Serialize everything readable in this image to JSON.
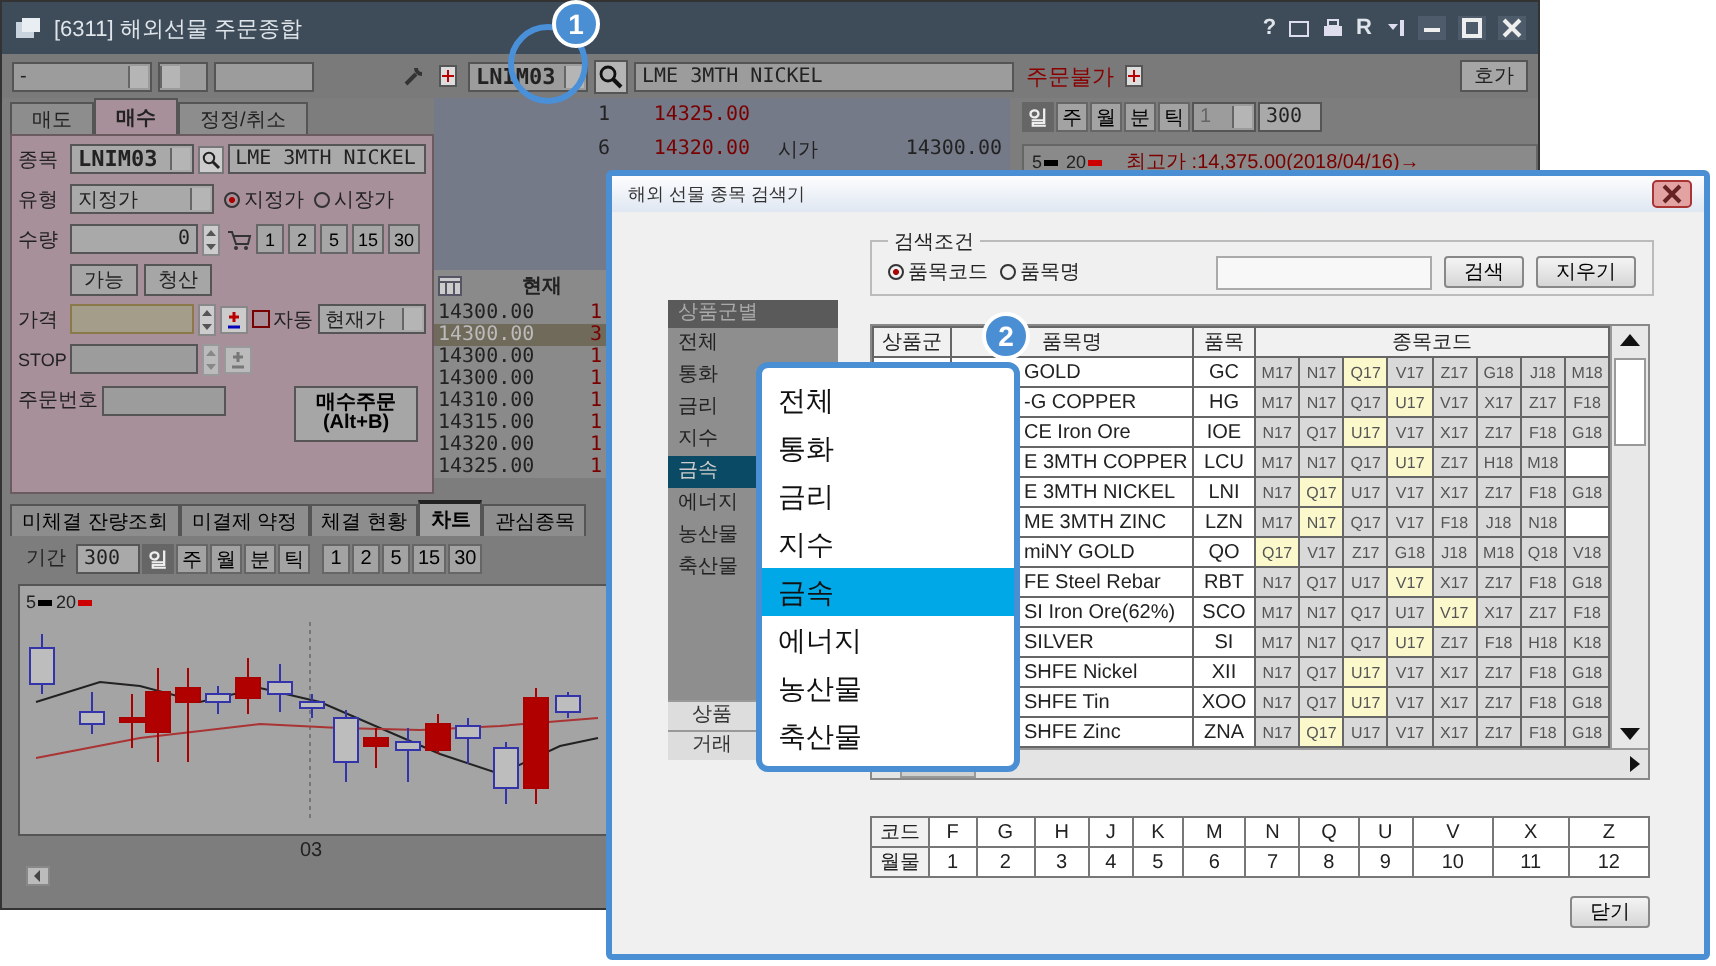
{
  "window": {
    "title": "[6311] 해외선물 주문종합",
    "glyphs": [
      "?",
      "R"
    ]
  },
  "toolbar": {
    "account": "-",
    "symbol": "LNIM03",
    "symbol_name": "LME 3MTH NICKEL",
    "status": "주문불가",
    "quote_button": "호가"
  },
  "order_tabs": [
    {
      "label": "매도",
      "selected": false
    },
    {
      "label": "매수",
      "selected": true
    },
    {
      "label": "정정/취소",
      "selected": false
    }
  ],
  "order_form": {
    "symbol_label": "종목",
    "symbol": "LNIM03",
    "symbol_name": "LME 3MTH NICKEL",
    "type_label": "유형",
    "type_value": "지정가",
    "price_types": [
      {
        "label": "지정가",
        "selected": true
      },
      {
        "label": "시장가",
        "selected": false
      }
    ],
    "qty_label": "수량",
    "qty": "0",
    "qty_presets": [
      "1",
      "2",
      "5",
      "15",
      "30"
    ],
    "buttons": [
      "가능",
      "청산"
    ],
    "price_label": "가격",
    "auto": {
      "label": "자동",
      "checked": false
    },
    "price_source": "현재가",
    "stop_label": "STOP",
    "order_no_label": "주문번호",
    "submit": "매수주문\n(Alt+B)"
  },
  "quotes": [
    {
      "count": "1",
      "price": "14325.00"
    },
    {
      "count": "6",
      "price": "14320.00",
      "label": "시가",
      "value": "14300.00"
    }
  ],
  "ticks": {
    "header": "현재",
    "rows": [
      {
        "price": "14300.00",
        "qty": "1",
        "selected": false
      },
      {
        "price": "14300.00",
        "qty": "3",
        "selected": true
      },
      {
        "price": "14300.00",
        "qty": "1",
        "selected": false
      },
      {
        "price": "14300.00",
        "qty": "1",
        "selected": false
      },
      {
        "price": "14310.00",
        "qty": "1",
        "selected": false
      },
      {
        "price": "14315.00",
        "qty": "1",
        "selected": false
      },
      {
        "price": "14320.00",
        "qty": "1",
        "selected": false
      },
      {
        "price": "14325.00",
        "qty": "1",
        "selected": false
      }
    ]
  },
  "mini_chart": {
    "periods": [
      {
        "label": "일",
        "selected": true
      },
      {
        "label": "주",
        "selected": false
      },
      {
        "label": "월",
        "selected": false
      },
      {
        "label": "분",
        "selected": false
      },
      {
        "label": "틱",
        "selected": false
      }
    ],
    "interval": "1",
    "count": "300",
    "legend": [
      {
        "label": "5",
        "color": "#000000"
      },
      {
        "label": "20",
        "color": "#cc0000"
      }
    ],
    "high_note": "최고가 :14,375.00(2018/04/16)→"
  },
  "bottom_tabs": [
    {
      "label": "미체결 잔량조회",
      "selected": false
    },
    {
      "label": "미결제 약정",
      "selected": false
    },
    {
      "label": "체결 현황",
      "selected": false
    },
    {
      "label": "차트",
      "selected": true
    },
    {
      "label": "관심종목",
      "selected": false
    }
  ],
  "chart": {
    "period_label": "기간",
    "period_value": "300",
    "periods": [
      {
        "label": "일",
        "selected": true
      },
      {
        "label": "주",
        "selected": false
      },
      {
        "label": "월",
        "selected": false
      },
      {
        "label": "분",
        "selected": false
      },
      {
        "label": "틱",
        "selected": false
      }
    ],
    "intervals": [
      "1",
      "2",
      "5",
      "15",
      "30"
    ],
    "legend": [
      {
        "label": "5",
        "color": "#000000"
      },
      {
        "label": "20",
        "color": "#cc0000"
      }
    ],
    "x_label": "03"
  },
  "dialog": {
    "title": "해외 선물 종목 검색기",
    "search": {
      "legend": "검색조건",
      "modes": [
        {
          "label": "품목코드",
          "selected": true
        },
        {
          "label": "품목명",
          "selected": false
        }
      ],
      "buttons": [
        "검색",
        "지우기"
      ]
    },
    "groups": {
      "header": "상품군별",
      "items": [
        {
          "label": "전체",
          "selected": false
        },
        {
          "label": "통화",
          "selected": false
        },
        {
          "label": "금리",
          "selected": false
        },
        {
          "label": "지수",
          "selected": false
        },
        {
          "label": "금속",
          "selected": true
        },
        {
          "label": "에너지",
          "selected": false
        },
        {
          "label": "농산물",
          "selected": false
        },
        {
          "label": "축산물",
          "selected": false
        }
      ],
      "footer": [
        "상품",
        "거래"
      ]
    },
    "table": {
      "columns": [
        "상품군",
        "품목명",
        "품목",
        "종목코드"
      ],
      "rows": [
        {
          "name": "GOLD",
          "code": "GC",
          "contracts": [
            {
              "code": "M17",
              "highlighted": false
            },
            {
              "code": "N17",
              "highlighted": false
            },
            {
              "code": "Q17",
              "highlighted": true
            },
            {
              "code": "V17",
              "highlighted": false
            },
            {
              "code": "Z17",
              "highlighted": false
            },
            {
              "code": "G18",
              "highlighted": false
            },
            {
              "code": "J18",
              "highlighted": false
            },
            {
              "code": "M18",
              "highlighted": false
            }
          ]
        },
        {
          "name": "-G COPPER",
          "code": "HG",
          "contracts": [
            {
              "code": "M17",
              "highlighted": false
            },
            {
              "code": "N17",
              "highlighted": false
            },
            {
              "code": "Q17",
              "highlighted": false
            },
            {
              "code": "U17",
              "highlighted": true
            },
            {
              "code": "V17",
              "highlighted": false
            },
            {
              "code": "X17",
              "highlighted": false
            },
            {
              "code": "Z17",
              "highlighted": false
            },
            {
              "code": "F18",
              "highlighted": false
            }
          ]
        },
        {
          "name": "CE Iron Ore",
          "code": "IOE",
          "contracts": [
            {
              "code": "N17",
              "highlighted": false
            },
            {
              "code": "Q17",
              "highlighted": false
            },
            {
              "code": "U17",
              "highlighted": true
            },
            {
              "code": "V17",
              "highlighted": false
            },
            {
              "code": "X17",
              "highlighted": false
            },
            {
              "code": "Z17",
              "highlighted": false
            },
            {
              "code": "F18",
              "highlighted": false
            },
            {
              "code": "G18",
              "highlighted": false
            }
          ]
        },
        {
          "name": "E 3MTH COPPER",
          "code": "LCU",
          "contracts": [
            {
              "code": "M17",
              "highlighted": false
            },
            {
              "code": "N17",
              "highlighted": false
            },
            {
              "code": "Q17",
              "highlighted": false
            },
            {
              "code": "U17",
              "highlighted": true
            },
            {
              "code": "Z17",
              "highlighted": false
            },
            {
              "code": "H18",
              "highlighted": false
            },
            {
              "code": "M18",
              "highlighted": false
            }
          ]
        },
        {
          "name": "E 3MTH NICKEL",
          "code": "LNI",
          "contracts": [
            {
              "code": "N17",
              "highlighted": false
            },
            {
              "code": "Q17",
              "highlighted": true
            },
            {
              "code": "U17",
              "highlighted": false
            },
            {
              "code": "V17",
              "highlighted": false
            },
            {
              "code": "X17",
              "highlighted": false
            },
            {
              "code": "Z17",
              "highlighted": false
            },
            {
              "code": "F18",
              "highlighted": false
            },
            {
              "code": "G18",
              "highlighted": false
            }
          ]
        },
        {
          "name": "ME 3MTH ZINC",
          "code": "LZN",
          "contracts": [
            {
              "code": "M17",
              "highlighted": false
            },
            {
              "code": "N17",
              "highlighted": true
            },
            {
              "code": "Q17",
              "highlighted": false
            },
            {
              "code": "V17",
              "highlighted": false
            },
            {
              "code": "F18",
              "highlighted": false
            },
            {
              "code": "J18",
              "highlighted": false
            },
            {
              "code": "N18",
              "highlighted": false
            }
          ]
        },
        {
          "name": "miNY GOLD",
          "code": "QO",
          "contracts": [
            {
              "code": "Q17",
              "highlighted": true
            },
            {
              "code": "V17",
              "highlighted": false
            },
            {
              "code": "Z17",
              "highlighted": false
            },
            {
              "code": "G18",
              "highlighted": false
            },
            {
              "code": "J18",
              "highlighted": false
            },
            {
              "code": "M18",
              "highlighted": false
            },
            {
              "code": "Q18",
              "highlighted": false
            },
            {
              "code": "V18",
              "highlighted": false
            }
          ]
        },
        {
          "name": "FE Steel Rebar",
          "code": "RBT",
          "contracts": [
            {
              "code": "N17",
              "highlighted": false
            },
            {
              "code": "Q17",
              "highlighted": false
            },
            {
              "code": "U17",
              "highlighted": false
            },
            {
              "code": "V17",
              "highlighted": true
            },
            {
              "code": "X17",
              "highlighted": false
            },
            {
              "code": "Z17",
              "highlighted": false
            },
            {
              "code": "F18",
              "highlighted": false
            },
            {
              "code": "G18",
              "highlighted": false
            }
          ]
        },
        {
          "name": "SI Iron Ore(62%)",
          "code": "SCO",
          "contracts": [
            {
              "code": "M17",
              "highlighted": false
            },
            {
              "code": "N17",
              "highlighted": false
            },
            {
              "code": "Q17",
              "highlighted": false
            },
            {
              "code": "U17",
              "highlighted": false
            },
            {
              "code": "V17",
              "highlighted": true
            },
            {
              "code": "X17",
              "highlighted": false
            },
            {
              "code": "Z17",
              "highlighted": false
            },
            {
              "code": "F18",
              "highlighted": false
            }
          ]
        },
        {
          "name": "SILVER",
          "code": "SI",
          "contracts": [
            {
              "code": "M17",
              "highlighted": false
            },
            {
              "code": "N17",
              "highlighted": false
            },
            {
              "code": "Q17",
              "highlighted": false
            },
            {
              "code": "U17",
              "highlighted": true
            },
            {
              "code": "Z17",
              "highlighted": false
            },
            {
              "code": "F18",
              "highlighted": false
            },
            {
              "code": "H18",
              "highlighted": false
            },
            {
              "code": "K18",
              "highlighted": false
            }
          ]
        },
        {
          "name": "SHFE Nickel",
          "code": "XII",
          "contracts": [
            {
              "code": "N17",
              "highlighted": false
            },
            {
              "code": "Q17",
              "highlighted": false
            },
            {
              "code": "U17",
              "highlighted": true
            },
            {
              "code": "V17",
              "highlighted": false
            },
            {
              "code": "X17",
              "highlighted": false
            },
            {
              "code": "Z17",
              "highlighted": false
            },
            {
              "code": "F18",
              "highlighted": false
            },
            {
              "code": "G18",
              "highlighted": false
            }
          ]
        },
        {
          "name": "SHFE Tin",
          "code": "XOO",
          "contracts": [
            {
              "code": "N17",
              "highlighted": false
            },
            {
              "code": "Q17",
              "highlighted": false
            },
            {
              "code": "U17",
              "highlighted": true
            },
            {
              "code": "V17",
              "highlighted": false
            },
            {
              "code": "X17",
              "highlighted": false
            },
            {
              "code": "Z17",
              "highlighted": false
            },
            {
              "code": "F18",
              "highlighted": false
            },
            {
              "code": "G18",
              "highlighted": false
            }
          ]
        },
        {
          "name": "SHFE Zinc",
          "code": "ZNA",
          "contracts": [
            {
              "code": "N17",
              "highlighted": false
            },
            {
              "code": "Q17",
              "highlighted": true
            },
            {
              "code": "U17",
              "highlighted": false
            },
            {
              "code": "V17",
              "highlighted": false
            },
            {
              "code": "X17",
              "highlighted": false
            },
            {
              "code": "Z17",
              "highlighted": false
            },
            {
              "code": "F18",
              "highlighted": false
            },
            {
              "code": "G18",
              "highlighted": false
            }
          ]
        }
      ]
    },
    "months": {
      "row_labels": [
        "코드",
        "월물"
      ],
      "codes": [
        "F",
        "G",
        "H",
        "J",
        "K",
        "M",
        "N",
        "Q",
        "U",
        "V",
        "X",
        "Z"
      ],
      "numbers": [
        "1",
        "2",
        "3",
        "4",
        "5",
        "6",
        "7",
        "8",
        "9",
        "10",
        "11",
        "12"
      ]
    },
    "close_button": "닫기"
  },
  "popup": {
    "items": [
      {
        "label": "전체",
        "selected": false
      },
      {
        "label": "통화",
        "selected": false
      },
      {
        "label": "금리",
        "selected": false
      },
      {
        "label": "지수",
        "selected": false
      },
      {
        "label": "금속",
        "selected": true
      },
      {
        "label": "에너지",
        "selected": false
      },
      {
        "label": "농산물",
        "selected": false
      },
      {
        "label": "축산물",
        "selected": false
      }
    ]
  },
  "callouts": [
    "1",
    "2"
  ]
}
